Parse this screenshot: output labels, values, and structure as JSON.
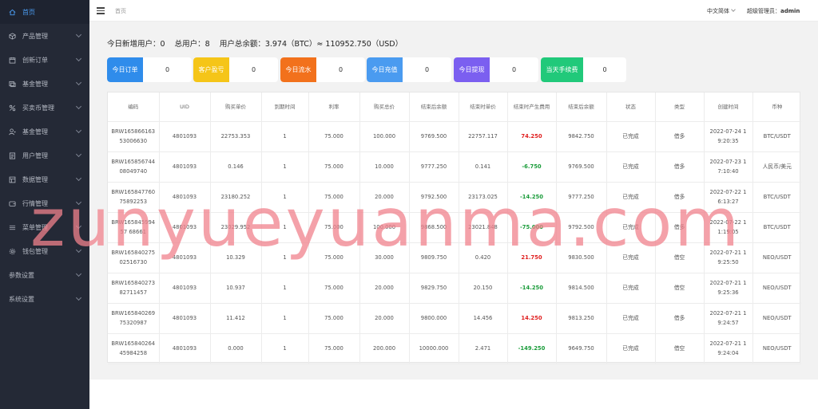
{
  "sidebar": {
    "items": [
      {
        "label": "首页",
        "icon": "home-icon",
        "active": true,
        "chevron": false
      },
      {
        "label": "产品管理",
        "icon": "cube-icon",
        "active": false,
        "chevron": true
      },
      {
        "label": "创新订单",
        "icon": "calendar-icon",
        "active": false,
        "chevron": true
      },
      {
        "label": "基金管理",
        "icon": "stack-icon",
        "active": false,
        "chevron": true
      },
      {
        "label": "买卖币管理",
        "icon": "percent-icon",
        "active": false,
        "chevron": true
      },
      {
        "label": "基金管理",
        "icon": "fund-icon",
        "active": false,
        "chevron": true
      },
      {
        "label": "用户管理",
        "icon": "user-icon",
        "active": false,
        "chevron": true
      },
      {
        "label": "数据管理",
        "icon": "grid-icon",
        "active": false,
        "chevron": true
      },
      {
        "label": "行情管理",
        "icon": "wallet-icon",
        "active": false,
        "chevron": true
      },
      {
        "label": "菜单管理",
        "icon": "menu-icon",
        "active": false,
        "chevron": true
      },
      {
        "label": "钱包管理",
        "icon": "gear-icon",
        "active": false,
        "chevron": true
      },
      {
        "label": "参数设置",
        "icon": "",
        "active": false,
        "chevron": true
      },
      {
        "label": "系统设置",
        "icon": "",
        "active": false,
        "chevron": true
      }
    ]
  },
  "topbar": {
    "breadcrumb": "首页",
    "language": "中文简体",
    "user_prefix": "超级管理员：",
    "user_name": "admin"
  },
  "summary": {
    "new_users_label": "今日新增用户：",
    "new_users_value": "0",
    "total_users_label": "总用户：",
    "total_users_value": "8",
    "balance_label": "用户总余额：",
    "balance_value": "3.974（BTC）≈ 110952.750（USD）"
  },
  "cards": [
    {
      "label": "今日订单",
      "value": "0",
      "color": "#2f8ceb"
    },
    {
      "label": "客户盈亏",
      "value": "0",
      "color": "#f5c518"
    },
    {
      "label": "今日流水",
      "value": "0",
      "color": "#f2711c"
    },
    {
      "label": "今日充值",
      "value": "0",
      "color": "#4a9bf0"
    },
    {
      "label": "今日提现",
      "value": "0",
      "color": "#7b5ff0"
    },
    {
      "label": "当天手续费",
      "value": "0",
      "color": "#21c97a"
    }
  ],
  "table": {
    "headers": [
      "编码",
      "UID",
      "购买单价",
      "到期时间",
      "利率",
      "购买总价",
      "结束后余额",
      "结束时单价",
      "结束时产生费用",
      "结束后余额",
      "状态",
      "类型",
      "创建时间",
      "币种"
    ],
    "rows": [
      [
        "BRW16586616353006630",
        "4801093",
        "22753.353",
        "1",
        "75.000",
        "100.000",
        "9769.500",
        "22757.117",
        "74.250",
        "9842.750",
        "已完成",
        "借多",
        "2022-07-24 19:20:35",
        "BTC/USDT"
      ],
      [
        "BRW16585674408049740",
        "4801093",
        "0.146",
        "1",
        "75.000",
        "10.000",
        "9777.250",
        "0.141",
        "-6.750",
        "9769.500",
        "已完成",
        "借多",
        "2022-07-23 17:10:40",
        "人民币/美元"
      ],
      [
        "BRW16584776075892253",
        "4801093",
        "23180.252",
        "1",
        "75.000",
        "20.000",
        "9792.500",
        "23173.025",
        "-14.250",
        "9777.250",
        "已完成",
        "借多",
        "2022-07-22 16:13:27",
        "BTC/USDT"
      ],
      [
        "BRW16584599457 68661",
        "4801093",
        "23029.952",
        "1",
        "75.000",
        "100.000",
        "9868.500",
        "23021.848",
        "-75.000",
        "9792.500",
        "已完成",
        "借多",
        "2022-07-22 11:19:05",
        "BTC/USDT"
      ],
      [
        "BRW16584027502516730",
        "4801093",
        "10.329",
        "1",
        "75.000",
        "30.000",
        "9809.750",
        "0.420",
        "21.750",
        "9830.500",
        "已完成",
        "借空",
        "2022-07-21 19:25:50",
        "NEO/USDT"
      ],
      [
        "BRW16584027382711457",
        "4801093",
        "10.937",
        "1",
        "75.000",
        "20.000",
        "9829.750",
        "20.150",
        "-14.250",
        "9814.500",
        "已完成",
        "借空",
        "2022-07-21 19:25:36",
        "NEO/USDT"
      ],
      [
        "BRW16584026975320987",
        "4801093",
        "11.412",
        "1",
        "75.000",
        "20.000",
        "9800.000",
        "14.456",
        "14.250",
        "9813.250",
        "已完成",
        "借多",
        "2022-07-21 19:24:57",
        "NEO/USDT"
      ],
      [
        "BRW16584026445984258",
        "4801093",
        "0.000",
        "1",
        "75.000",
        "200.000",
        "10000.000",
        "2.471",
        "-149.250",
        "9649.750",
        "已完成",
        "借空",
        "2022-07-21 19:24:04",
        "NEO/USDT"
      ]
    ]
  },
  "watermark": "zunyueyuanma.com"
}
